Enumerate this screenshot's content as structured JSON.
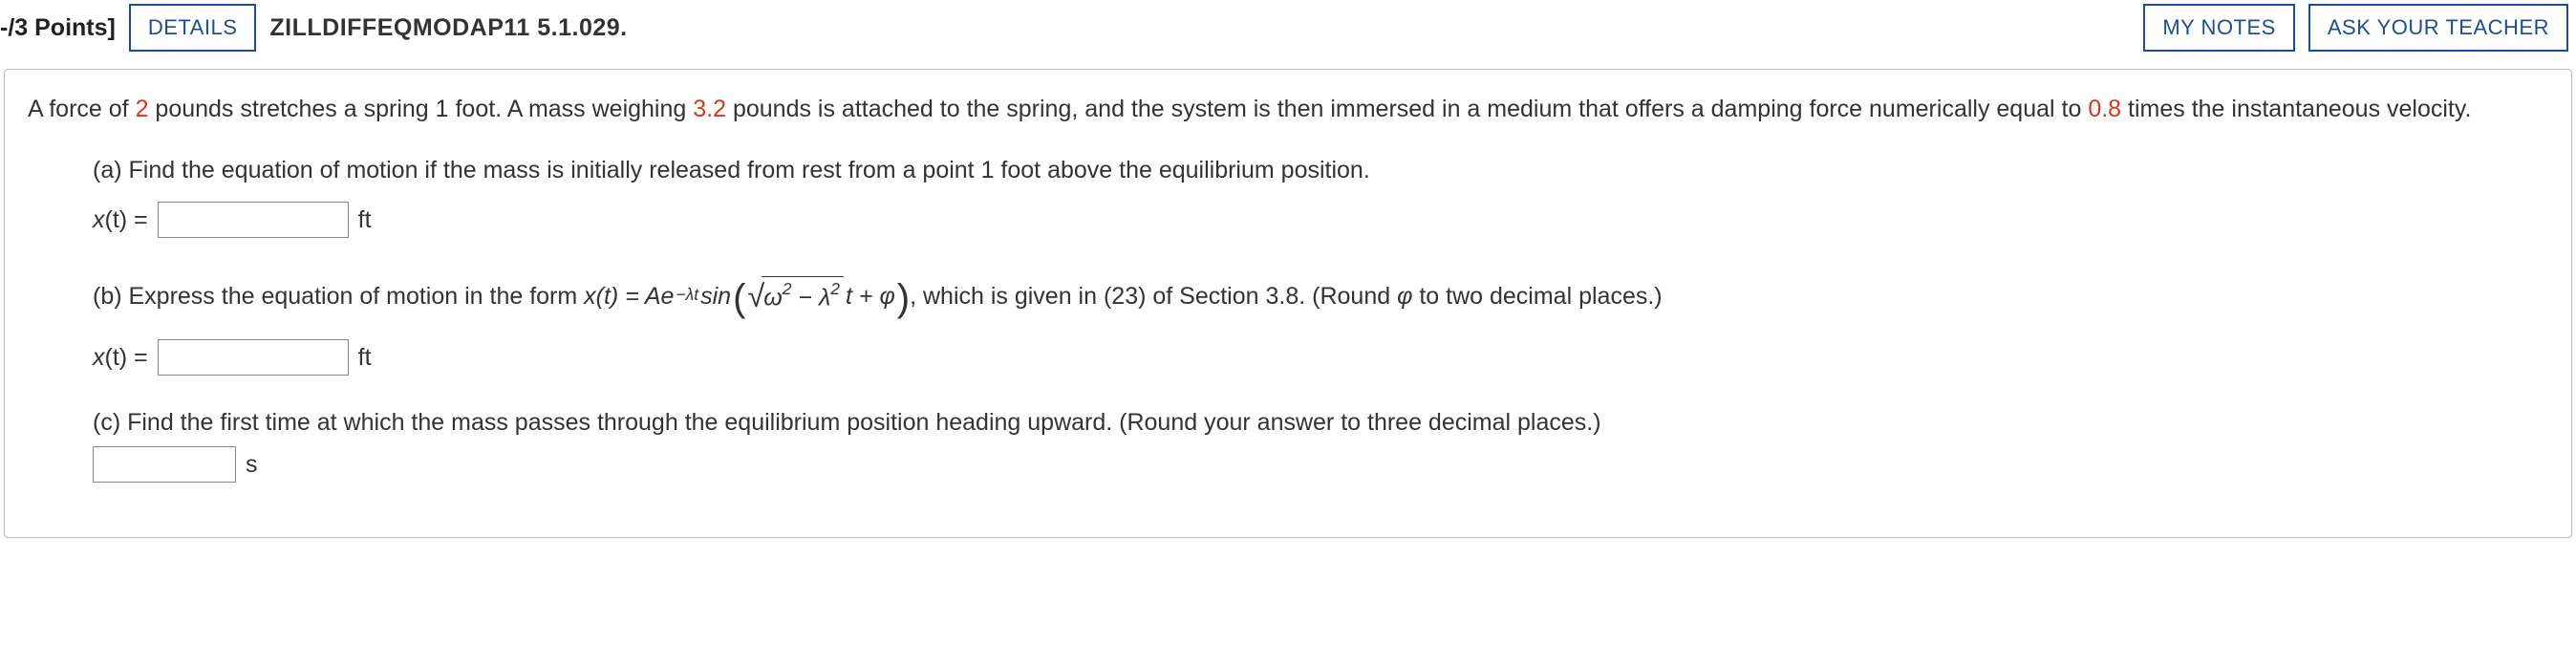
{
  "header": {
    "points": "-/3 Points]",
    "details_btn": "DETAILS",
    "textbook": "ZILLDIFFEQMODAP11 5.1.029.",
    "mynotes_btn": "MY NOTES",
    "ask_btn": "ASK YOUR TEACHER"
  },
  "intro": {
    "t1": "A force of ",
    "n1": "2",
    "t2": " pounds stretches a spring 1 foot. A mass weighing ",
    "n2": "3.2",
    "t3": " pounds is attached to the spring, and the system is then immersed in a medium that offers a damping force numerically equal to ",
    "n3": "0.8",
    "t4": " times the instantaneous velocity."
  },
  "part_a": {
    "prompt": "(a) Find the equation of motion if the mass is initially released from rest from a point 1 foot above the equilibrium position.",
    "var": "x",
    "arg": "(t)",
    "eq": " = ",
    "unit": "ft"
  },
  "part_b": {
    "prefix": "(b) Express the equation of motion in the form ",
    "xt": "x(t) = Ae",
    "exp": "−λt",
    "sin": " sin",
    "sqrt_arg_w": "ω",
    "sqrt_arg_sq1": "2",
    "sqrt_arg_minus": " − ",
    "sqrt_arg_l": "λ",
    "sqrt_arg_sq2": "2",
    "after_sqrt": "t + φ",
    "suffix": ", which is given in (23) of Section 3.8. (Round ",
    "phi": "φ",
    "suffix2": " to two decimal places.)",
    "var": "x",
    "arg": "(t)",
    "eq": " = ",
    "unit": "ft"
  },
  "part_c": {
    "prompt": "(c) Find the first time at which the mass passes through the equilibrium position heading upward. (Round your answer to three decimal places.)",
    "unit": "s"
  }
}
